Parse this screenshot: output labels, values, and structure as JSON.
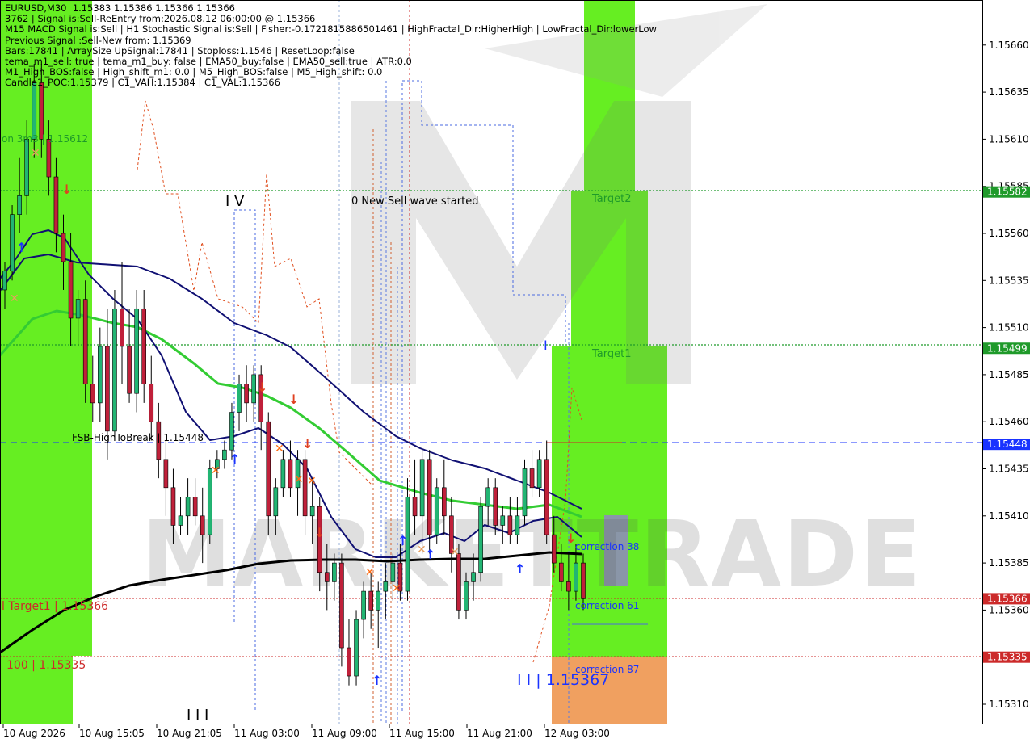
{
  "chart_data": {
    "type": "candlestick",
    "symbol": "EURUSD,M30",
    "info_lines": [
      "EURUSD,M30  1.15383 1.15386 1.15366 1.15366",
      "3762 | Signal is:Sell-ReEntry from:2026.08.12 06:00:00 @ 1.15366",
      "M15 MACD Signal is:Sell | H1 Stochastic Signal is:Sell | Fisher:-0.1721815886501461 | HighFractal_Dir:HigherHigh | LowFractal_Dir:lowerLow",
      "Previous Signal :Sell-New from: 1.15369",
      "Bars:17841 | ArraySize UpSignal:17841 | Stoploss:1.1546 | ResetLoop:false",
      "tema_m1_sell: true | tema_m1_buy: false | EMA50_buy:false | EMA50_sell:true | ATR:0.0",
      "M1_High_BOS:false | High_shift_m1: 0.0 | M5_High_BOS:false | M5_High_shift: 0.0",
      "Candle1_POC:1.15379 | C1_VAH:1.15384 | C1_VAL:1.15366"
    ],
    "y_ticks": [
      "1.15660",
      "1.15635",
      "1.15610",
      "1.15585",
      "1.15560",
      "1.15535",
      "1.15510",
      "1.15485",
      "1.15460",
      "1.15435",
      "1.15410",
      "1.15385",
      "1.15360",
      "1.15310"
    ],
    "x_ticks": [
      "10 Aug 2026",
      "10 Aug 15:05",
      "10 Aug 21:05",
      "11 Aug 03:00",
      "11 Aug 09:00",
      "11 Aug 15:00",
      "11 Aug 21:00",
      "12 Aug 03:00"
    ],
    "price_labels": [
      {
        "value": "1.15582",
        "color": "#1f9a2a"
      },
      {
        "value": "1.15499",
        "color": "#1f9a2a"
      },
      {
        "value": "1.15448",
        "color": "#1a33ff"
      },
      {
        "value": "1.15366",
        "color": "#cc2a2a"
      },
      {
        "value": "1.15335",
        "color": "#cc2a2a"
      }
    ],
    "annotations": {
      "fsb": "FSB-HighToBreak | 1.15448",
      "target1_left": "l Target1 | 1.15366",
      "level100": "100 | 1.15335",
      "wave_iv": "I V",
      "wave_iii": "I I I",
      "new_sell": "0 New Sell wave started",
      "target2": "Target2",
      "target1": "Target1",
      "corr38": "correction 38",
      "corr61": "correction 61",
      "corr87": "correction 87",
      "wave_ii": "I I | 1.15367",
      "marker_i": "I",
      "left_label": "on 3m3 | 1.15612",
      "watermark": "MARKETTRADE"
    },
    "candles_ohlc": [
      [
        1.1553,
        1.15545,
        1.1552,
        1.1554
      ],
      [
        1.1554,
        1.15575,
        1.15535,
        1.1557
      ],
      [
        1.1557,
        1.156,
        1.1556,
        1.1558
      ],
      [
        1.1558,
        1.1562,
        1.1557,
        1.1561
      ],
      [
        1.1561,
        1.1565,
        1.156,
        1.1564
      ],
      [
        1.1564,
        1.1565,
        1.156,
        1.1561
      ],
      [
        1.1561,
        1.1562,
        1.1558,
        1.1559
      ],
      [
        1.1559,
        1.156,
        1.1555,
        1.1556
      ],
      [
        1.1556,
        1.1557,
        1.1553,
        1.15545
      ],
      [
        1.15545,
        1.1556,
        1.155,
        1.15515
      ],
      [
        1.15515,
        1.1553,
        1.155,
        1.15525
      ],
      [
        1.15525,
        1.15535,
        1.1547,
        1.1548
      ],
      [
        1.1548,
        1.15495,
        1.1546,
        1.1547
      ],
      [
        1.1547,
        1.1551,
        1.1546,
        1.155
      ],
      [
        1.155,
        1.1552,
        1.1544,
        1.15455
      ],
      [
        1.15455,
        1.1553,
        1.1545,
        1.1552
      ],
      [
        1.1552,
        1.15545,
        1.1548,
        1.155
      ],
      [
        1.155,
        1.1552,
        1.1547,
        1.15475
      ],
      [
        1.15475,
        1.1553,
        1.15465,
        1.1552
      ],
      [
        1.1552,
        1.1553,
        1.1547,
        1.1548
      ],
      [
        1.1548,
        1.15495,
        1.1545,
        1.1546
      ],
      [
        1.1546,
        1.1547,
        1.1543,
        1.1544
      ],
      [
        1.1544,
        1.1545,
        1.1541,
        1.15425
      ],
      [
        1.15425,
        1.15435,
        1.15395,
        1.15405
      ],
      [
        1.15405,
        1.1542,
        1.154,
        1.1541
      ],
      [
        1.1541,
        1.1543,
        1.154,
        1.1542
      ],
      [
        1.1542,
        1.1543,
        1.15405,
        1.1541
      ],
      [
        1.1541,
        1.15425,
        1.15385,
        1.154
      ],
      [
        1.154,
        1.1544,
        1.15395,
        1.15435
      ],
      [
        1.15435,
        1.15445,
        1.1543,
        1.1544
      ],
      [
        1.1544,
        1.1545,
        1.15435,
        1.15445
      ],
      [
        1.15445,
        1.1547,
        1.1544,
        1.15465
      ],
      [
        1.15465,
        1.15485,
        1.15455,
        1.1548
      ],
      [
        1.1548,
        1.1549,
        1.1546,
        1.1547
      ],
      [
        1.1547,
        1.1549,
        1.1546,
        1.15485
      ],
      [
        1.15485,
        1.1549,
        1.15445,
        1.1546
      ],
      [
        1.1546,
        1.15465,
        1.154,
        1.1541
      ],
      [
        1.1541,
        1.1543,
        1.154,
        1.15425
      ],
      [
        1.15425,
        1.15445,
        1.1542,
        1.1544
      ],
      [
        1.1544,
        1.1545,
        1.1542,
        1.15425
      ],
      [
        1.15425,
        1.15445,
        1.1541,
        1.1544
      ],
      [
        1.1544,
        1.15445,
        1.154,
        1.1541
      ],
      [
        1.1541,
        1.1543,
        1.15395,
        1.15415
      ],
      [
        1.15415,
        1.1542,
        1.1537,
        1.1538
      ],
      [
        1.1538,
        1.15395,
        1.1536,
        1.15375
      ],
      [
        1.15375,
        1.1539,
        1.15365,
        1.15385
      ],
      [
        1.15385,
        1.1539,
        1.1533,
        1.1534
      ],
      [
        1.1534,
        1.15355,
        1.1532,
        1.15325
      ],
      [
        1.15325,
        1.1536,
        1.1532,
        1.15355
      ],
      [
        1.15355,
        1.15375,
        1.15345,
        1.1537
      ],
      [
        1.1537,
        1.1538,
        1.1535,
        1.1536
      ],
      [
        1.1536,
        1.15375,
        1.1534,
        1.1537
      ],
      [
        1.1537,
        1.15385,
        1.15355,
        1.15375
      ],
      [
        1.15375,
        1.1539,
        1.15365,
        1.15385
      ],
      [
        1.15385,
        1.15395,
        1.15365,
        1.1537
      ],
      [
        1.1537,
        1.1543,
        1.15365,
        1.1542
      ],
      [
        1.1542,
        1.1544,
        1.154,
        1.1541
      ],
      [
        1.1541,
        1.15445,
        1.1539,
        1.1544
      ],
      [
        1.1544,
        1.15445,
        1.1539,
        1.154
      ],
      [
        1.154,
        1.1543,
        1.15395,
        1.15425
      ],
      [
        1.15425,
        1.1544,
        1.154,
        1.1541
      ],
      [
        1.1541,
        1.1542,
        1.1538,
        1.1539
      ],
      [
        1.1539,
        1.15395,
        1.15355,
        1.1536
      ],
      [
        1.1536,
        1.1538,
        1.15355,
        1.15375
      ],
      [
        1.15375,
        1.1539,
        1.15365,
        1.1538
      ],
      [
        1.1538,
        1.1542,
        1.15375,
        1.15415
      ],
      [
        1.15415,
        1.1543,
        1.15405,
        1.15425
      ],
      [
        1.15425,
        1.1543,
        1.154,
        1.15405
      ],
      [
        1.15405,
        1.15415,
        1.15395,
        1.1541
      ],
      [
        1.1541,
        1.1542,
        1.15395,
        1.154
      ],
      [
        1.154,
        1.1542,
        1.15395,
        1.1541
      ],
      [
        1.1541,
        1.1544,
        1.15405,
        1.15435
      ],
      [
        1.15435,
        1.15445,
        1.1542,
        1.15425
      ],
      [
        1.15425,
        1.15445,
        1.1542,
        1.1544
      ],
      [
        1.1544,
        1.1545,
        1.15395,
        1.154
      ],
      [
        1.154,
        1.1541,
        1.1538,
        1.15385
      ],
      [
        1.15385,
        1.15395,
        1.1537,
        1.15375
      ],
      [
        1.15375,
        1.1539,
        1.1536,
        1.1537
      ],
      [
        1.1537,
        1.15395,
        1.15365,
        1.15385
      ],
      [
        1.15385,
        1.1539,
        1.1536,
        1.15366
      ]
    ],
    "ylim": [
      1.153,
      1.1568
    ],
    "colors": {
      "bull": "#22b573",
      "bear": "#c0203a",
      "ema_blue": "#101073",
      "ema_green": "#33cc33",
      "sma_black": "#000000",
      "green_zone": "#66ee22",
      "orange_zone": "#f0a060",
      "accent_blue": "#1a33ff",
      "accent_red": "#cc2a2a"
    }
  }
}
